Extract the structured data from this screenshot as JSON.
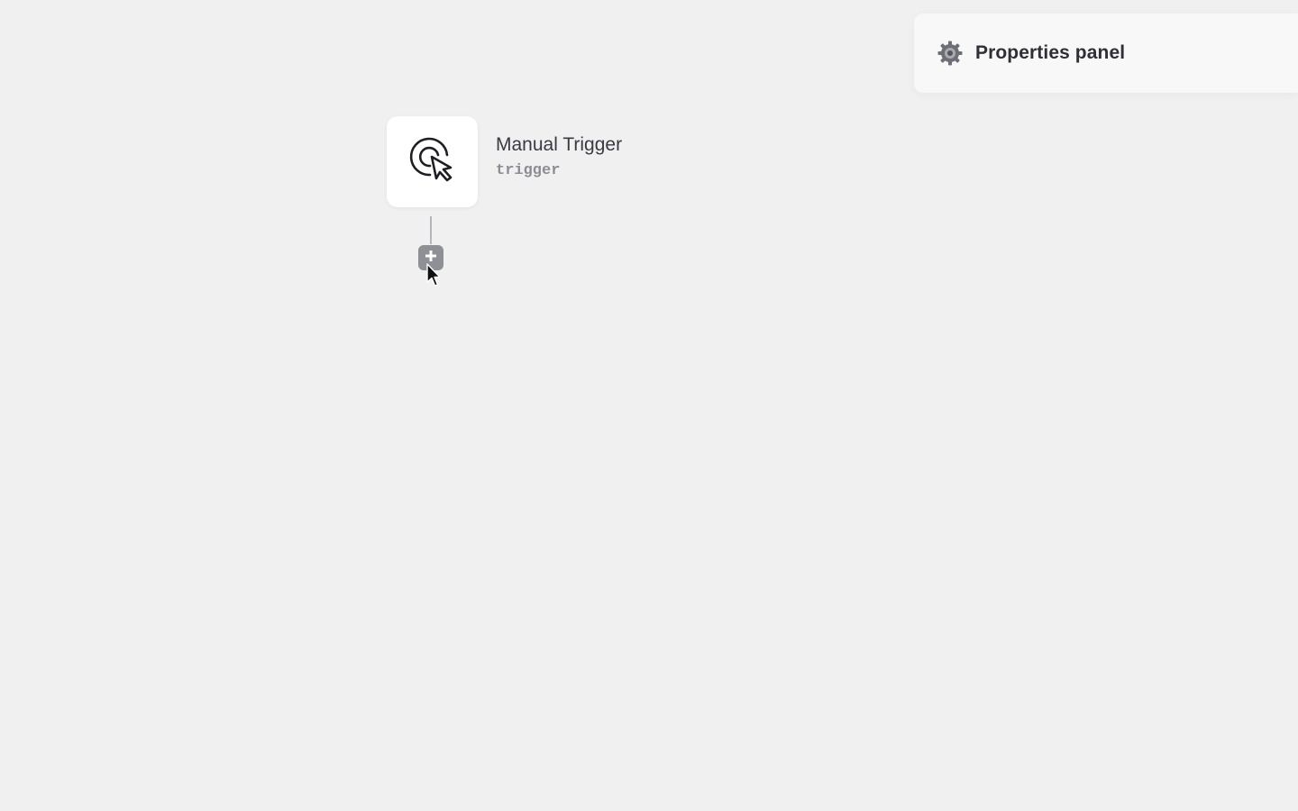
{
  "properties_panel": {
    "title": "Properties panel",
    "icon": "gear-icon"
  },
  "node": {
    "title": "Manual Trigger",
    "subtitle": "trigger",
    "icon": "cursor-click-icon"
  },
  "add_button": {
    "icon": "plus-icon"
  },
  "colors": {
    "canvas_bg": "#f0f0f1",
    "panel_bg": "#f8f8f9",
    "node_bg": "#ffffff",
    "add_button_bg": "#8f8f96"
  }
}
